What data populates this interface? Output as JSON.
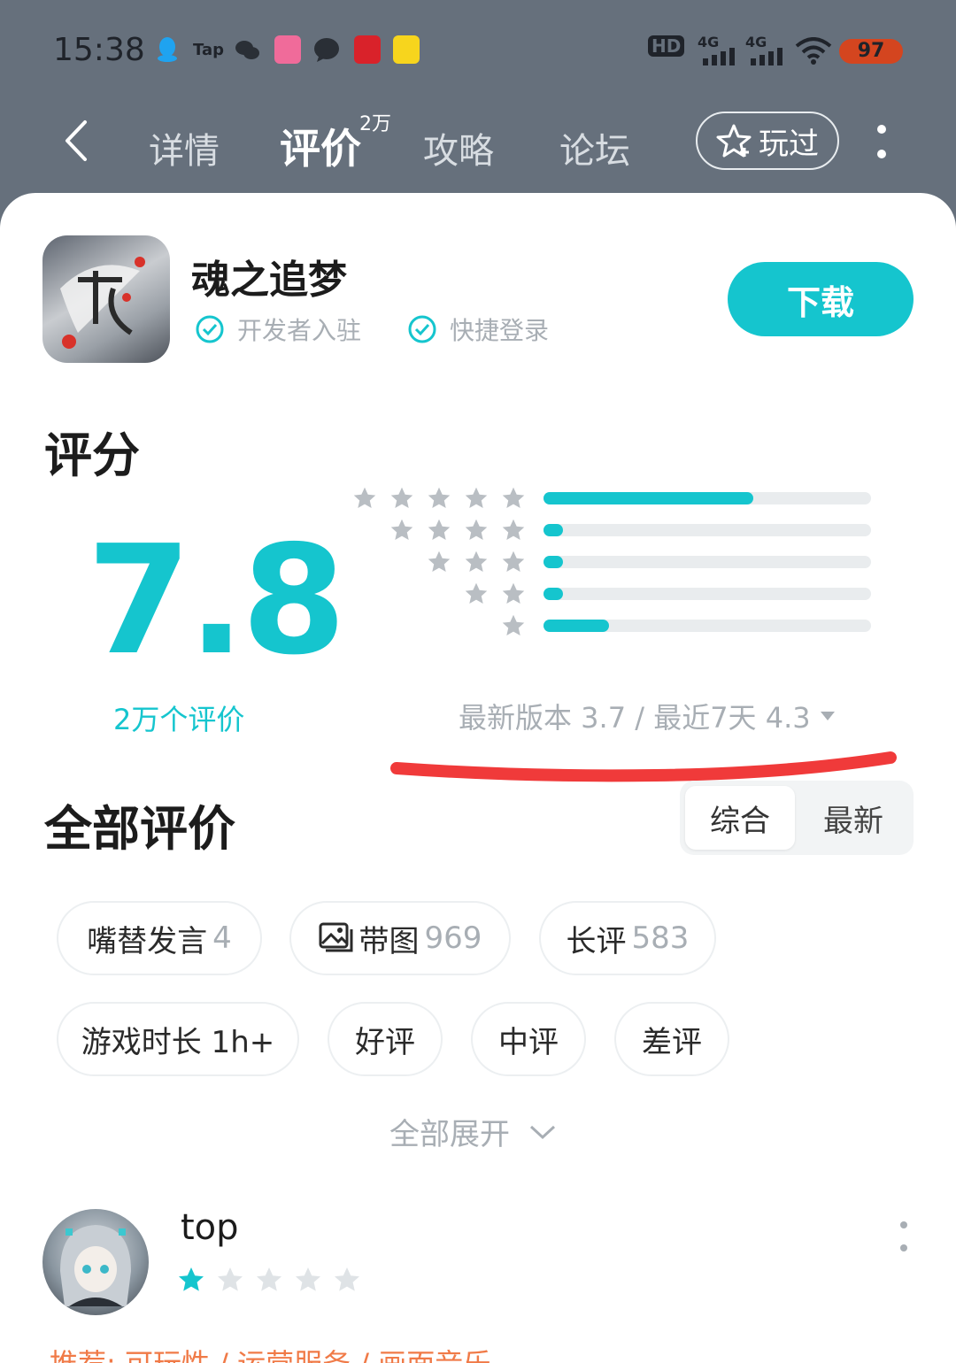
{
  "status_bar": {
    "time": "15:38",
    "battery": "97",
    "icons": [
      "qq-icon",
      "tap-icon",
      "wechat-icon",
      "bilibili-icon",
      "message-icon",
      "app-icon",
      "app-icon-yellow",
      "hd-icon",
      "signal-4g-icon",
      "signal-4g-icon",
      "wifi-icon"
    ],
    "tap_text": "Tap",
    "hd_text": "HD",
    "net1": "4G",
    "net2": "4G"
  },
  "nav": {
    "tabs": [
      {
        "label": "详情"
      },
      {
        "label": "评价",
        "badge": "2万"
      },
      {
        "label": "攻略"
      },
      {
        "label": "论坛"
      }
    ],
    "played_label": "玩过"
  },
  "app": {
    "name": "魂之追梦",
    "tags": [
      "开发者入驻",
      "快捷登录"
    ],
    "download_label": "下载"
  },
  "rating": {
    "section_title": "评分",
    "score": "7.8",
    "review_count": "2万个评价",
    "distribution": [
      {
        "stars": 5,
        "fraction": 0.64
      },
      {
        "stars": 4,
        "fraction": 0.06
      },
      {
        "stars": 3,
        "fraction": 0.05
      },
      {
        "stars": 2,
        "fraction": 0.05
      },
      {
        "stars": 1,
        "fraction": 0.2
      }
    ],
    "version_text": "最新版本 3.7 / 最近7天 4.3",
    "accent_color": "#15c5ce"
  },
  "reviews": {
    "section_title": "全部评价",
    "sort": {
      "active": "综合",
      "other": "最新"
    },
    "filters": [
      {
        "label": "嘴替发言",
        "count": "4"
      },
      {
        "label": "带图",
        "count": "969"
      },
      {
        "label": "长评",
        "count": "583"
      },
      {
        "label": "游戏时长 1h+"
      },
      {
        "label": "好评"
      },
      {
        "label": "中评"
      },
      {
        "label": "差评"
      }
    ],
    "expand_label": "全部展开"
  },
  "post": {
    "username": "top",
    "rating": 1,
    "max_rating": 5,
    "recommend": "推荐: 可玩性 / 运营服务 / 画面音乐"
  }
}
